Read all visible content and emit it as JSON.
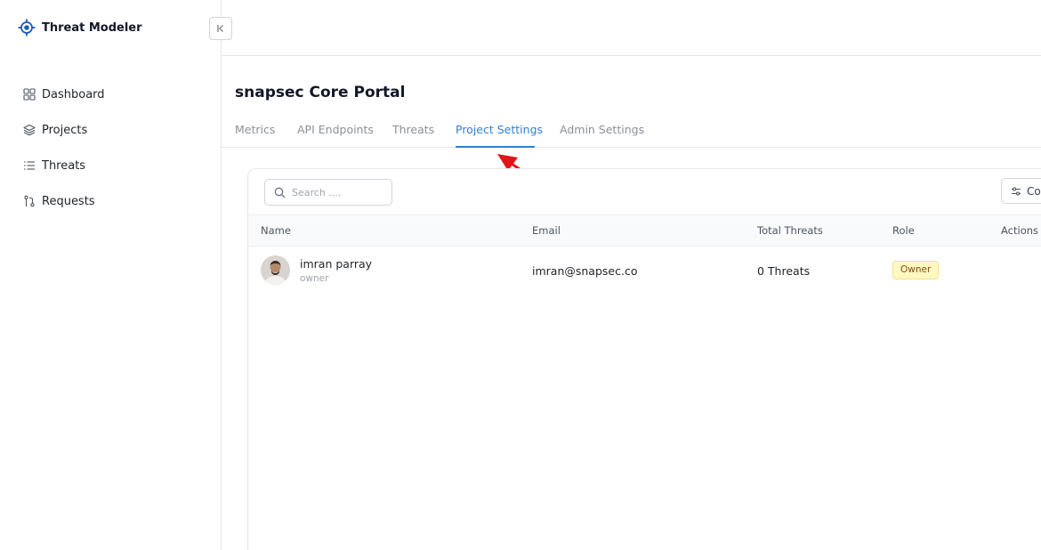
{
  "app": {
    "brand_name": "Threat Modeler"
  },
  "sidebar": {
    "items": [
      {
        "label": "Dashboard",
        "icon": "grid-icon"
      },
      {
        "label": "Projects",
        "icon": "layers-icon"
      },
      {
        "label": "Threats",
        "icon": "list-icon"
      },
      {
        "label": "Requests",
        "icon": "git-pull-request-icon"
      }
    ]
  },
  "project": {
    "title": "snapsec Core Portal"
  },
  "tabs": [
    {
      "label": "Metrics",
      "active": false
    },
    {
      "label": "API Endpoints",
      "active": false
    },
    {
      "label": "Threats",
      "active": false
    },
    {
      "label": "Project Settings",
      "active": true
    },
    {
      "label": "Admin Settings",
      "active": false
    }
  ],
  "toolbar": {
    "search_placeholder": "Search ....",
    "columns_label": "Co"
  },
  "table": {
    "headers": [
      "Name",
      "Email",
      "Total Threats",
      "Role",
      "Actions"
    ],
    "rows": [
      {
        "name": "imran parray",
        "subtitle": "owner",
        "email": "imran@snapsec.co",
        "total_threats": "0 Threats",
        "role": "Owner"
      }
    ]
  },
  "colors": {
    "accent": "#2f7fd6",
    "annotation_arrow": "#e3151a",
    "badge_bg": "#fef9c3"
  }
}
